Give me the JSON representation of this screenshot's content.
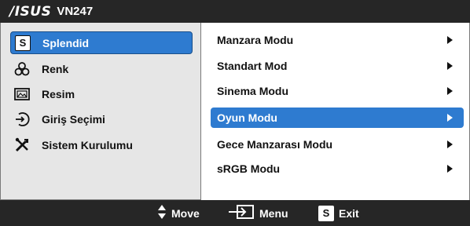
{
  "header": {
    "brand": "/ISUS",
    "model": "VN247"
  },
  "main_menu": [
    {
      "label": "Splendid",
      "icon": "splendid-s-icon",
      "active": true
    },
    {
      "label": "Renk",
      "icon": "color-icon",
      "active": false
    },
    {
      "label": "Resim",
      "icon": "image-icon",
      "active": false
    },
    {
      "label": "Giriş Seçimi",
      "icon": "input-select-icon",
      "active": false
    },
    {
      "label": "Sistem Kurulumu",
      "icon": "tools-icon",
      "active": false
    }
  ],
  "sub_menu": [
    {
      "label": "Manzara Modu",
      "active": false
    },
    {
      "label": "Standart Mod",
      "active": false
    },
    {
      "label": "Sinema Modu",
      "active": false
    },
    {
      "label": "Oyun Modu",
      "active": true
    },
    {
      "label": "Gece Manzarası Modu",
      "active": false
    },
    {
      "label": "sRGB Modu",
      "active": false
    }
  ],
  "footer": {
    "move_label": "Move",
    "menu_label": "Menu",
    "exit_label": "Exit",
    "exit_badge": "S"
  },
  "splendid_badge": "S",
  "colors": {
    "accent": "#2e7bd0",
    "bar": "#262626",
    "panel": "#e6e6e6"
  }
}
